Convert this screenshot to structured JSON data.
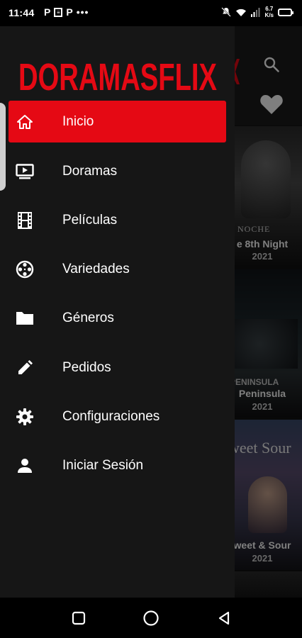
{
  "status_bar": {
    "time": "11:44",
    "notification_icons": [
      "P",
      "news-icon",
      "P",
      "more-dots"
    ],
    "net_speed_value": "6.7",
    "net_speed_unit": "K/s"
  },
  "app": {
    "brand": "DORAMASFLIX",
    "brand_color": "#e50914",
    "accent_color": "#e50914"
  },
  "drawer": {
    "items": [
      {
        "label": "Inicio",
        "icon": "home-icon",
        "active": true
      },
      {
        "label": "Doramas",
        "icon": "tv-play-icon",
        "active": false
      },
      {
        "label": "Películas",
        "icon": "film-strip-icon",
        "active": false
      },
      {
        "label": "Variedades",
        "icon": "film-reel-icon",
        "active": false
      },
      {
        "label": "Géneros",
        "icon": "folder-icon",
        "active": false
      },
      {
        "label": "Pedidos",
        "icon": "pencil-icon",
        "active": false
      },
      {
        "label": "Configuraciones",
        "icon": "gear-icon",
        "active": false
      },
      {
        "label": "Iniciar Sesión",
        "icon": "person-icon",
        "active": false
      }
    ]
  },
  "background_content": {
    "posters": [
      {
        "title": "e 8th Night",
        "year": "2021",
        "art_text": "8 NOCHE"
      },
      {
        "title": "Peninsula",
        "year": "2021",
        "art_text": "PENINSULA"
      },
      {
        "title": "weet & Sour",
        "year": "2021",
        "art_text": "weet Sour"
      }
    ]
  },
  "nav_bar": {
    "buttons": [
      "recents-icon",
      "home-circle-icon",
      "back-triangle-icon"
    ]
  }
}
